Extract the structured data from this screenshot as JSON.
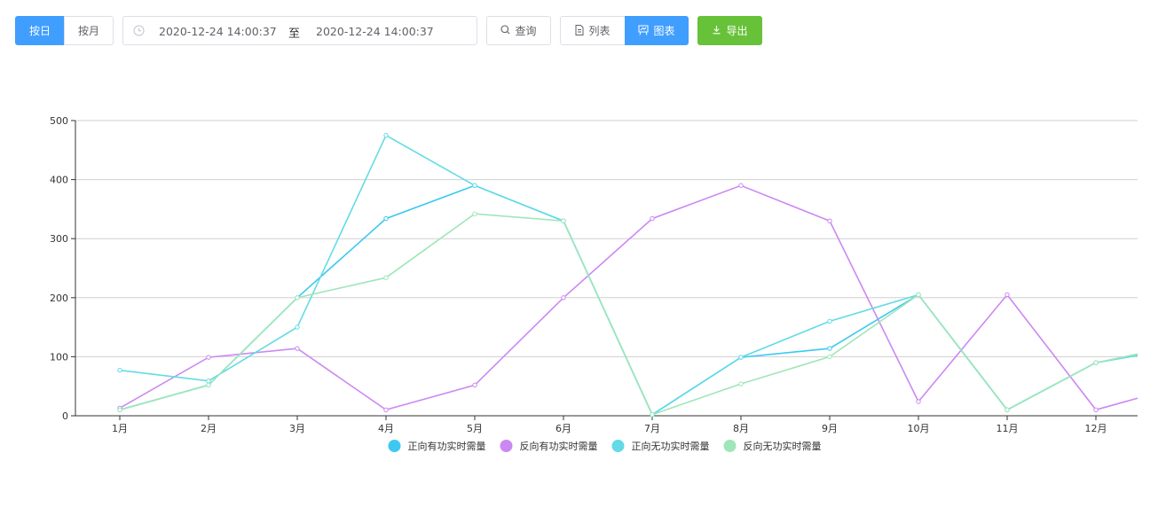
{
  "toolbar": {
    "by_day": "按日",
    "by_month": "按月",
    "date_start": "2020-12-24 14:00:37",
    "date_separator": "至",
    "date_end": "2020-12-24 14:00:37",
    "query": "查询",
    "list": "列表",
    "chart": "图表",
    "export": "导出"
  },
  "colors": {
    "primary": "#409eff",
    "success": "#67c23a",
    "border": "#dcdfe6"
  },
  "chart_data": {
    "type": "line",
    "categories": [
      "1月",
      "2月",
      "3月",
      "4月",
      "5月",
      "6月",
      "7月",
      "8月",
      "9月",
      "10月",
      "11月",
      "12月"
    ],
    "ylim": [
      0,
      500
    ],
    "yticks": [
      0,
      100,
      200,
      300,
      400,
      500
    ],
    "grid": true,
    "legend_position": "bottom-center",
    "series": [
      {
        "name": "正向有功实时需量",
        "color": "#3dc8f2",
        "values": [
          10,
          52,
          200,
          334,
          390,
          330,
          2,
          99,
          114,
          205,
          10,
          90
        ],
        "tail_value": 116
      },
      {
        "name": "反向有功实时需量",
        "color": "#cc88f2",
        "values": [
          13,
          99,
          114,
          10,
          52,
          200,
          334,
          390,
          330,
          24,
          205,
          10
        ],
        "tail_value": 52
      },
      {
        "name": "正向无功实时需量",
        "color": "#62dbe6",
        "values": [
          77,
          59,
          150,
          475,
          390,
          330,
          2,
          99,
          160,
          205,
          10,
          90
        ],
        "tail_value": 116
      },
      {
        "name": "反向无功实时需量",
        "color": "#9fe6b8",
        "values": [
          10,
          52,
          200,
          234,
          342,
          330,
          2,
          54,
          100,
          205,
          10,
          90
        ],
        "tail_value": 121
      }
    ]
  }
}
